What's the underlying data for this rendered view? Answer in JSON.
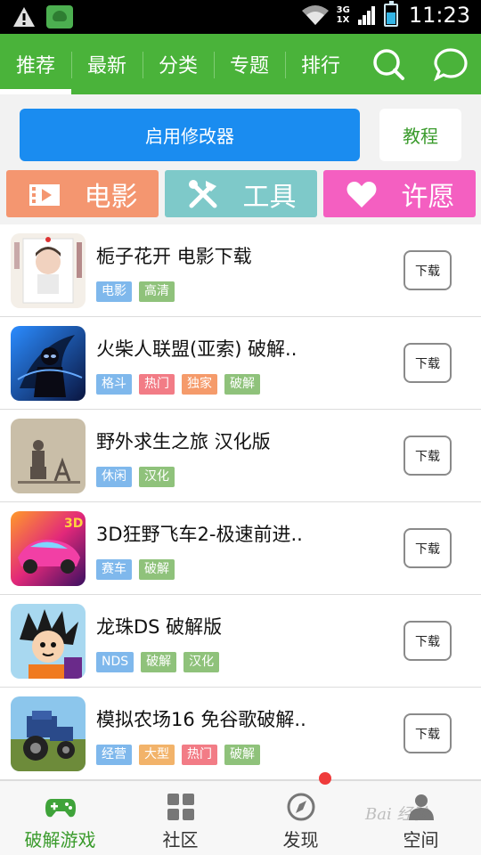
{
  "status_bar": {
    "time": "11:23",
    "network": [
      "3G",
      "1X"
    ]
  },
  "top_nav": {
    "tabs": [
      {
        "label": "推荐"
      },
      {
        "label": "最新"
      },
      {
        "label": "分类"
      },
      {
        "label": "专题"
      },
      {
        "label": "排行"
      }
    ],
    "icons": [
      "search-icon",
      "chat-icon"
    ]
  },
  "actions": {
    "primary": "启用修改器",
    "secondary": "教程"
  },
  "categories": [
    {
      "label": "电影",
      "icon": "film-icon",
      "color": "#f49670"
    },
    {
      "label": "工具",
      "icon": "tools-icon",
      "color": "#7ec9c9"
    },
    {
      "label": "许愿",
      "icon": "heart-icon",
      "color": "#f45fc1"
    }
  ],
  "apps": [
    {
      "title": "栀子花开  电影下载",
      "tags": [
        {
          "text": "电影",
          "color": "#7fb8ec"
        },
        {
          "text": "高清",
          "color": "#8fc27b"
        }
      ],
      "button": "下载",
      "icon": "movie-poster-thumbnail"
    },
    {
      "title": "火柴人联盟(亚索) 破解..",
      "tags": [
        {
          "text": "格斗",
          "color": "#7fb8ec"
        },
        {
          "text": "热门",
          "color": "#f27c86"
        },
        {
          "text": "独家",
          "color": "#f59b6b"
        },
        {
          "text": "破解",
          "color": "#8fc27b"
        }
      ],
      "button": "下载",
      "icon": "stickman-game-thumbnail"
    },
    {
      "title": "野外求生之旅  汉化版",
      "tags": [
        {
          "text": "休闲",
          "color": "#7fb8ec"
        },
        {
          "text": "汉化",
          "color": "#8fc27b"
        }
      ],
      "button": "下载",
      "icon": "survival-game-thumbnail"
    },
    {
      "title": "3D狂野飞车2-极速前进..",
      "tags": [
        {
          "text": "赛车",
          "color": "#7fb8ec"
        },
        {
          "text": "破解",
          "color": "#8fc27b"
        }
      ],
      "button": "下载",
      "icon": "racing-game-thumbnail"
    },
    {
      "title": "龙珠DS  破解版",
      "tags": [
        {
          "text": "NDS",
          "color": "#7fb8ec"
        },
        {
          "text": "破解",
          "color": "#8fc27b"
        },
        {
          "text": "汉化",
          "color": "#8fc27b"
        }
      ],
      "button": "下载",
      "icon": "dragonball-game-thumbnail"
    },
    {
      "title": "模拟农场16  免谷歌破解..",
      "tags": [
        {
          "text": "经营",
          "color": "#7fb8ec"
        },
        {
          "text": "大型",
          "color": "#f2b36a"
        },
        {
          "text": "热门",
          "color": "#f27c86"
        },
        {
          "text": "破解",
          "color": "#8fc27b"
        }
      ],
      "button": "下载",
      "icon": "farming-game-thumbnail"
    }
  ],
  "bottom_nav": [
    {
      "label": "破解游戏",
      "icon": "gamepad-icon"
    },
    {
      "label": "社区",
      "icon": "grid-icon"
    },
    {
      "label": "发现",
      "icon": "compass-icon"
    },
    {
      "label": "空间",
      "icon": "person-icon"
    }
  ],
  "watermark": "Bai 经验",
  "colors": {
    "nav_green": "#4ab33a",
    "primary_blue": "#1a8cf0",
    "accent_green": "#3a9b2c"
  }
}
